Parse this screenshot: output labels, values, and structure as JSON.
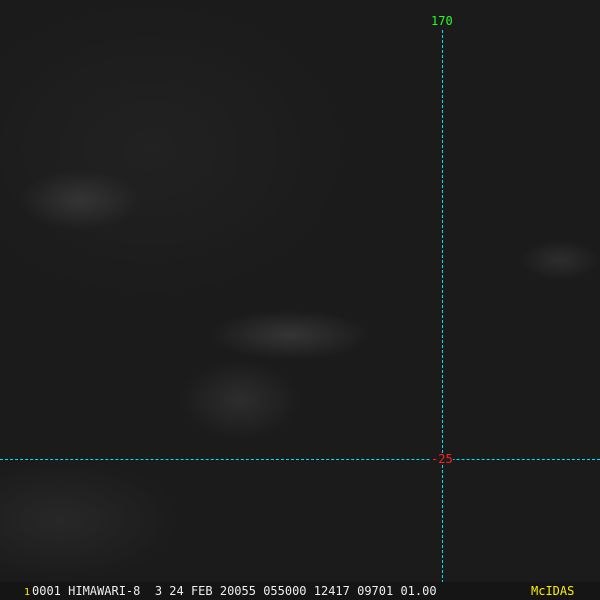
{
  "grid": {
    "longitude_label": "170",
    "latitude_label": "-25",
    "line_color": "#00e0ff"
  },
  "status_bar": {
    "frame": "1",
    "text": "0001 HIMAWARI-8  3 24 FEB 20055 055000 12417 09701 01.00",
    "logo": "McIDAS"
  }
}
